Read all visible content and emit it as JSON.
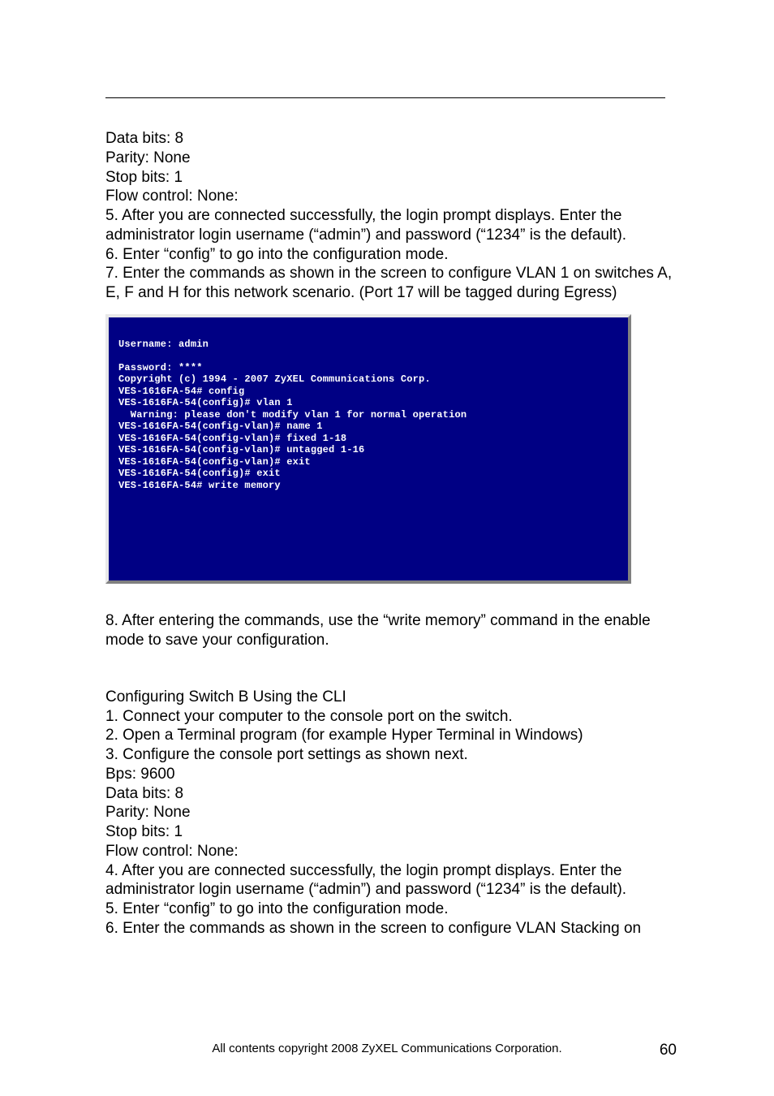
{
  "top_block": "Data bits: 8\nParity: None\nStop bits: 1\nFlow control: None:\n5. After you are connected successfully, the login prompt displays. Enter the administrator login username (“admin”) and password (“1234” is the default).\n6. Enter “config” to go into the configuration mode.\n7. Enter the commands as shown in the screen to configure VLAN 1 on switches A, E, F and H for this network scenario. (Port 17 will be tagged during Egress)",
  "terminal": "Username: admin\n\nPassword: ****\nCopyright (c) 1994 - 2007 ZyXEL Communications Corp.\nVES-1616FA-54# config\nVES-1616FA-54(config)# vlan 1\n  Warning: please don't modify vlan 1 for normal operation\nVES-1616FA-54(config-vlan)# name 1\nVES-1616FA-54(config-vlan)# fixed 1-18\nVES-1616FA-54(config-vlan)# untagged 1-16\nVES-1616FA-54(config-vlan)# exit\nVES-1616FA-54(config)# exit\nVES-1616FA-54# write memory",
  "mid_block": "8. After entering the commands, use the “write memory” command in the enable mode to save your configuration.",
  "section_heading": "Configuring Switch B Using the CLI",
  "bottom_block": "1. Connect your computer to the console port on the switch.\n2. Open a Terminal program (for example Hyper Terminal in Windows)\n3. Configure the console port settings as shown next.\nBps: 9600\nData bits: 8\nParity: None\nStop bits: 1\nFlow control: None:\n4. After you are connected successfully, the login prompt displays. Enter the administrator login username (“admin”) and password (“1234” is the default).\n5. Enter “config” to go into the configuration mode.\n6. Enter the commands as shown in the screen to configure VLAN Stacking on",
  "footer": "All contents copyright 2008 ZyXEL Communications Corporation.",
  "page_number": "60"
}
